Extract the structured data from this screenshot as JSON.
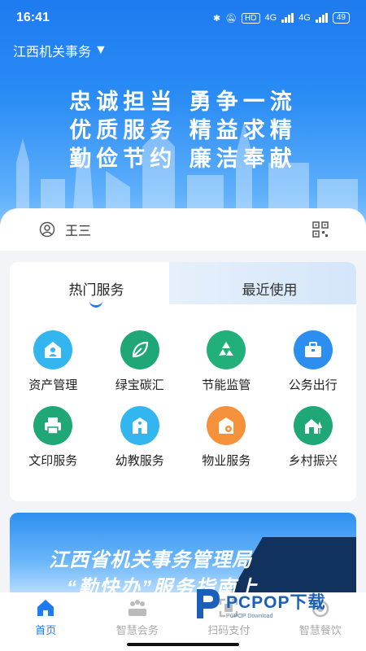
{
  "status_bar": {
    "time": "16:41",
    "hd_label": "HD",
    "net_1": "4G",
    "net_2": "4G",
    "battery": "49"
  },
  "header": {
    "org_name": "江西机关事务",
    "slogan_lines": [
      "忠诚担当 勇争一流",
      "优质服务 精益求精",
      "勤俭节约 廉洁奉献"
    ]
  },
  "user": {
    "name": "王三"
  },
  "services": {
    "tabs": [
      {
        "label": "热门服务",
        "active": true
      },
      {
        "label": "最近使用",
        "active": false
      }
    ],
    "items": [
      {
        "label": "资产管理",
        "icon": "house-person-icon",
        "color": "#33b6ef"
      },
      {
        "label": "绿宝碳汇",
        "icon": "leaf-icon",
        "color": "#1fa875"
      },
      {
        "label": "节能监管",
        "icon": "recycle-icon",
        "color": "#22b07a"
      },
      {
        "label": "公务出行",
        "icon": "briefcase-icon",
        "color": "#2b8ef0"
      },
      {
        "label": "文印服务",
        "icon": "printer-icon",
        "color": "#1fa875"
      },
      {
        "label": "幼教服务",
        "icon": "school-icon",
        "color": "#33b6ef"
      },
      {
        "label": "物业服务",
        "icon": "building-gear-icon",
        "color": "#f5913a"
      },
      {
        "label": "乡村振兴",
        "icon": "village-house-icon",
        "color": "#1fa875"
      }
    ]
  },
  "banner": {
    "title": "江西省机关事务管理局",
    "subtitle": "“勤快办”服务指南上"
  },
  "watermark": {
    "brand": "PCPOP下载",
    "small": "PCPOP Download"
  },
  "bottom_nav": [
    {
      "label": "首页",
      "icon": "home-icon",
      "active": true
    },
    {
      "label": "智慧会务",
      "icon": "meeting-icon",
      "active": false
    },
    {
      "label": "扫码支付",
      "icon": "scan-icon",
      "active": false
    },
    {
      "label": "智慧餐饮",
      "icon": "dining-icon",
      "active": false
    }
  ],
  "colors": {
    "primary": "#1e7bf0",
    "nav_inactive": "#aaaaaa"
  }
}
